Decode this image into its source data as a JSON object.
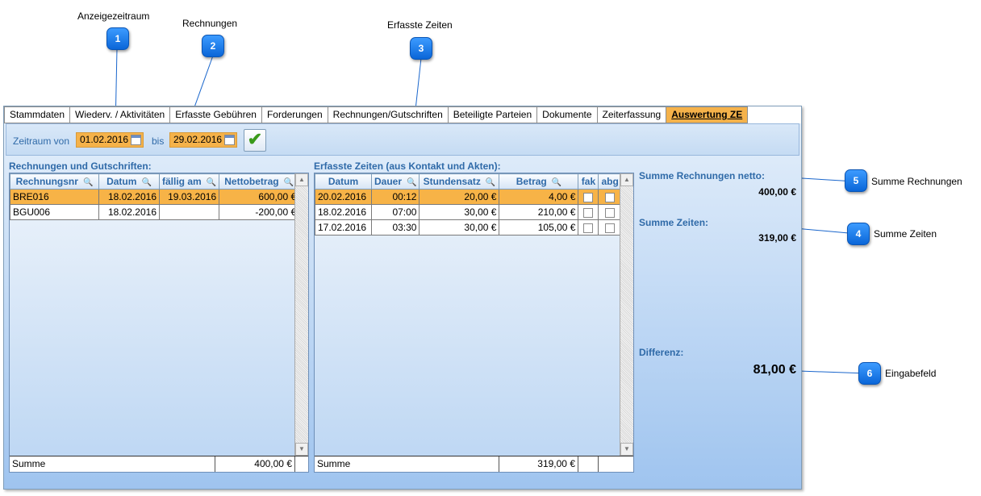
{
  "callouts": [
    {
      "num": "1",
      "label": "Anzeigezeitraum"
    },
    {
      "num": "2",
      "label": "Rechnungen"
    },
    {
      "num": "3",
      "label": "Erfasste Zeiten"
    },
    {
      "num": "4",
      "label": "Summe Zeiten"
    },
    {
      "num": "5",
      "label": "Summe Rechnungen"
    },
    {
      "num": "6",
      "label": "Eingabefeld"
    }
  ],
  "tabs": [
    "Stammdaten",
    "Wiederv. / Aktivitäten",
    "Erfasste Gebühren",
    "Forderungen",
    "Rechnungen/Gutschriften",
    "Beteiligte Parteien",
    "Dokumente",
    "Zeiterfassung",
    "Auswertung ZE"
  ],
  "filter": {
    "from_label": "Zeitraum von",
    "from": "01.02.2016",
    "to_label": "bis",
    "to": "29.02.2016"
  },
  "invoices": {
    "title": "Rechnungen und Gutschriften:",
    "headers": [
      "Rechnungsnr",
      "Datum",
      "fällig am",
      "Nettobetrag"
    ],
    "rows": [
      [
        "BRE016",
        "18.02.2016",
        "19.03.2016",
        "600,00 €"
      ],
      [
        "BGU006",
        "18.02.2016",
        "",
        "-200,00 €"
      ]
    ],
    "sum_label": "Summe",
    "sum_value": "400,00 €"
  },
  "times": {
    "title": "Erfasste Zeiten (aus Kontakt und Akten):",
    "headers": [
      "Datum",
      "Dauer",
      "Stundensatz",
      "Betrag",
      "fak",
      "abg"
    ],
    "rows": [
      [
        "20.02.2016",
        "00:12",
        "20,00 €",
        "4,00 €"
      ],
      [
        "18.02.2016",
        "07:00",
        "30,00 €",
        "210,00 €"
      ],
      [
        "17.02.2016",
        "03:30",
        "30,00 €",
        "105,00 €"
      ]
    ],
    "sum_label": "Summe",
    "sum_value": "319,00 €"
  },
  "summary": {
    "invoices_label": "Summe Rechnungen netto:",
    "invoices_value": "400,00 €",
    "times_label": "Summe Zeiten:",
    "times_value": "319,00 €",
    "diff_label": "Differenz:",
    "diff_value": "81,00 €"
  },
  "colors": {
    "accent": "#f5b24a",
    "label_blue": "#2f6aa8",
    "callout_blue": "#1a7ae8"
  }
}
